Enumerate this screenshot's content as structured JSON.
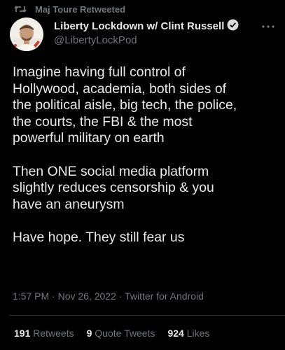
{
  "retweet_header": {
    "icon": "retweet-icon",
    "text": "Maj Toure Retweeted"
  },
  "author": {
    "avatar": "profile-photo",
    "display_name": "Liberty Lockdown w/ Clint Russell",
    "verified_icon": "verified-badge-icon",
    "handle": "@LibertyLockPod"
  },
  "more_icon": "more-options-icon",
  "tweet": {
    "text": "Imagine having full control of\nHollywood, academia, both sides of\nthe political aisle, big tech, the police,\nthe courts, the FBI & the most\npowerful military on earth\n\nThen ONE social media platform\nslightly reduces censorship & you\nhave an aneurysm\n\nHave hope. They still fear us",
    "time": "1:57 PM",
    "date": "Nov 26, 2022",
    "source": "Twitter for Android"
  },
  "stats": {
    "retweets_count": "191",
    "retweets_label": "Retweets",
    "quotes_count": "9",
    "quotes_label": "Quote Tweets",
    "likes_count": "924",
    "likes_label": "Likes"
  },
  "colors": {
    "background": "#000000",
    "primary_text": "#e7e9ea",
    "secondary_text": "#71767b",
    "divider": "#2f3336",
    "verified": "#d9d9d9"
  }
}
